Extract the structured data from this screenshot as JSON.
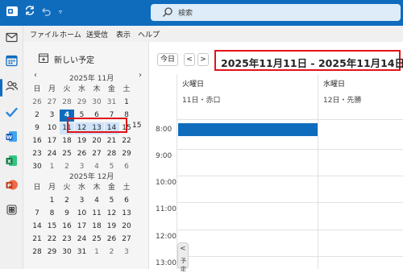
{
  "titlebar": {
    "search_placeholder": "検索",
    "icons": [
      "outlook-app-icon",
      "sync-icon",
      "undo-icon",
      "quick-access-dropdown-icon",
      "search-icon"
    ]
  },
  "menu": {
    "file": "ファイル",
    "home": "ホーム",
    "send_receive": "送受信",
    "view": "表示",
    "help": "ヘルプ"
  },
  "left": {
    "new_event": "新しい予定",
    "weekday_headers": [
      "日",
      "月",
      "火",
      "水",
      "木",
      "金",
      "土"
    ],
    "nov": {
      "title": "2025年 11月",
      "weeks": [
        [
          "26",
          "27",
          "28",
          "29",
          "30",
          "31",
          "1"
        ],
        [
          "2",
          "3",
          "4",
          "5",
          "6",
          "7",
          "8"
        ],
        [
          "9",
          "10",
          "11",
          "12",
          "13",
          "14",
          "15"
        ],
        [
          "16",
          "17",
          "18",
          "19",
          "20",
          "21",
          "22"
        ],
        [
          "23",
          "24",
          "25",
          "26",
          "27",
          "28",
          "29"
        ],
        [
          "30",
          "1",
          "2",
          "3",
          "4",
          "5",
          "6"
        ]
      ]
    },
    "dec": {
      "title": "2025年 12月",
      "weeks": [
        [
          "",
          "1",
          "2",
          "3",
          "4",
          "5",
          "6"
        ],
        [
          "7",
          "8",
          "9",
          "10",
          "11",
          "12",
          "13"
        ],
        [
          "14",
          "15",
          "16",
          "17",
          "18",
          "19",
          "20"
        ],
        [
          "21",
          "22",
          "23",
          "24",
          "25",
          "26",
          "27"
        ],
        [
          "28",
          "29",
          "30",
          "31",
          "1",
          "2",
          "3"
        ]
      ]
    }
  },
  "main": {
    "today_label": "今日",
    "prev_label": "<",
    "next_label": ">",
    "range_label": "2025年11月11日 - 2025年11月14日",
    "days": [
      {
        "name": "火曜日",
        "sub": "11日・赤口"
      },
      {
        "name": "水曜日",
        "sub": "12日・先勝"
      }
    ],
    "times": [
      "8:00",
      "9:00",
      "10:00",
      "11:00",
      "12:00",
      "13:00"
    ],
    "sidetab_label": "<",
    "sidetab_vertical": "予定"
  },
  "colors": {
    "accent": "#0f6cbd",
    "highlight_box": "#e0131a"
  }
}
